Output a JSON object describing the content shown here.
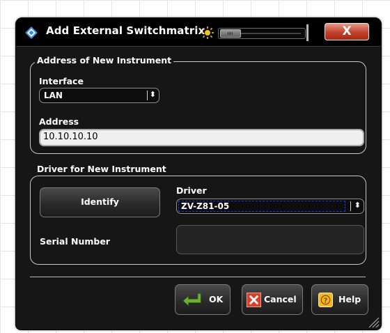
{
  "dialog": {
    "title": "Add External Switchmatrix",
    "close_label": "X"
  },
  "address_group": {
    "legend": "Address of New Instrument",
    "interface_label": "Interface",
    "interface_value": "LAN",
    "address_label": "Address",
    "address_value": "10.10.10.10"
  },
  "driver_group": {
    "legend": "Driver for New Instrument",
    "identify_label": "Identify",
    "driver_label": "Driver",
    "driver_value": "ZV-Z81-05",
    "serial_label": "Serial Number",
    "serial_value": ""
  },
  "buttons": {
    "ok_label": "OK",
    "cancel_label": "Cancel",
    "help_label": "Help"
  },
  "icons": {
    "app": "rs-diamond-icon",
    "brightness": "sun-icon",
    "ok": "enter-arrow-icon",
    "cancel": "x-icon",
    "help": "question-icon"
  },
  "colors": {
    "title_bg": "#000000",
    "dialog_bg": "#161616",
    "close_red": "#c0412b",
    "focus_dash": "#1c3bd6",
    "help_yellow": "#f2b71c"
  }
}
